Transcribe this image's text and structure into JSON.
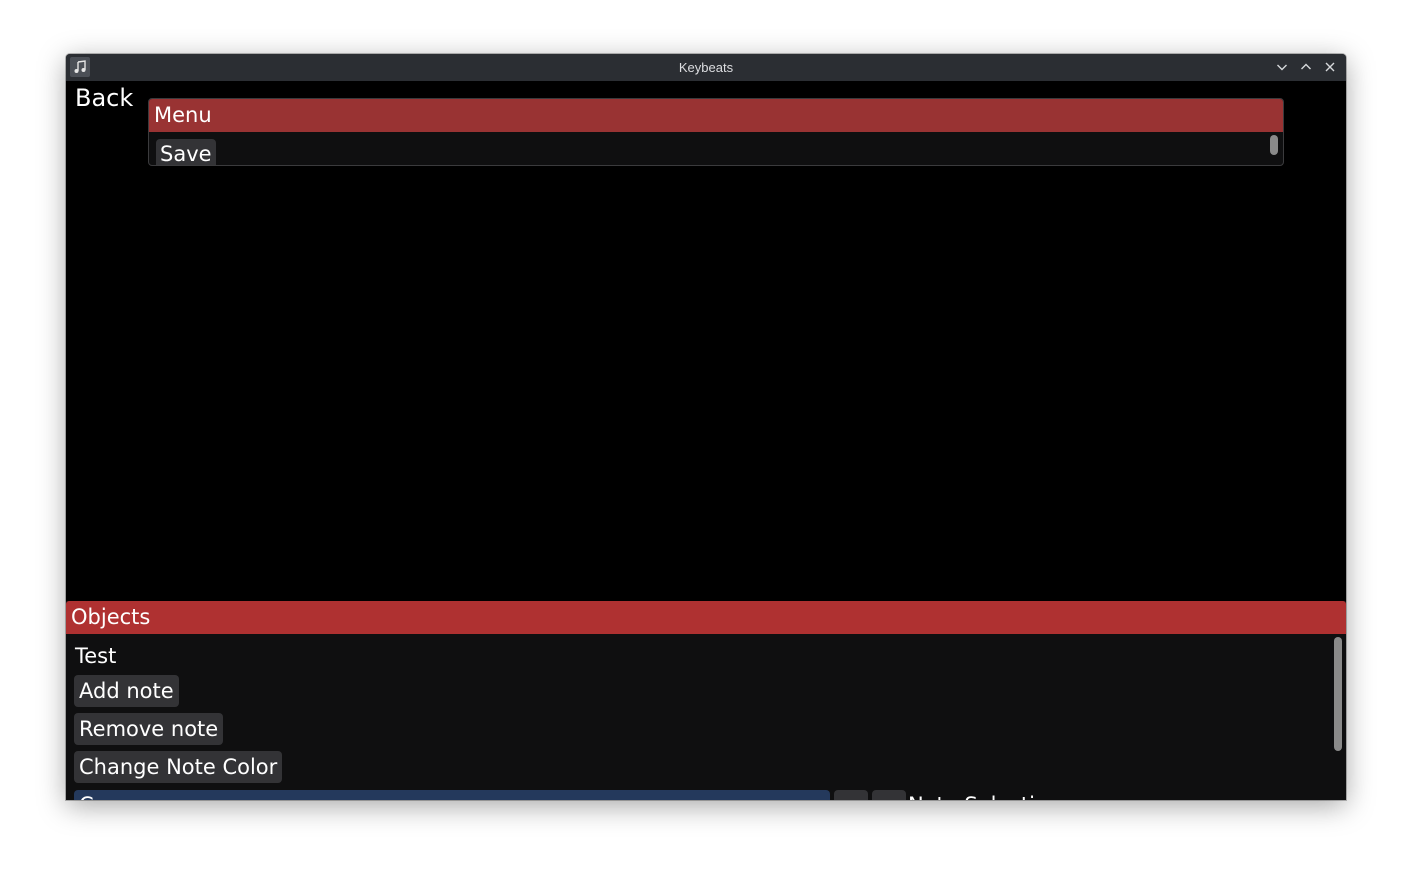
{
  "window": {
    "title": "Keybeats",
    "app_icon": "music-note-icon",
    "controls": [
      "minimize-icon",
      "maximize-icon",
      "close-icon"
    ]
  },
  "back_label": "Back",
  "menu": {
    "header": "Menu",
    "items": [
      {
        "label": "Save"
      }
    ]
  },
  "objects": {
    "header": "Objects",
    "object_name": "Test",
    "buttons": [
      {
        "label": "Add note"
      },
      {
        "label": "Remove note"
      },
      {
        "label": "Change Note Color"
      }
    ],
    "note_selection_label": "Note Selection",
    "combo_value": "C"
  },
  "colors": {
    "menu_header": "#993333",
    "objects_header": "#af3131",
    "combo_bg": "#24395c",
    "button_bg": "#333336",
    "panel_bg": "#0f0f10"
  }
}
